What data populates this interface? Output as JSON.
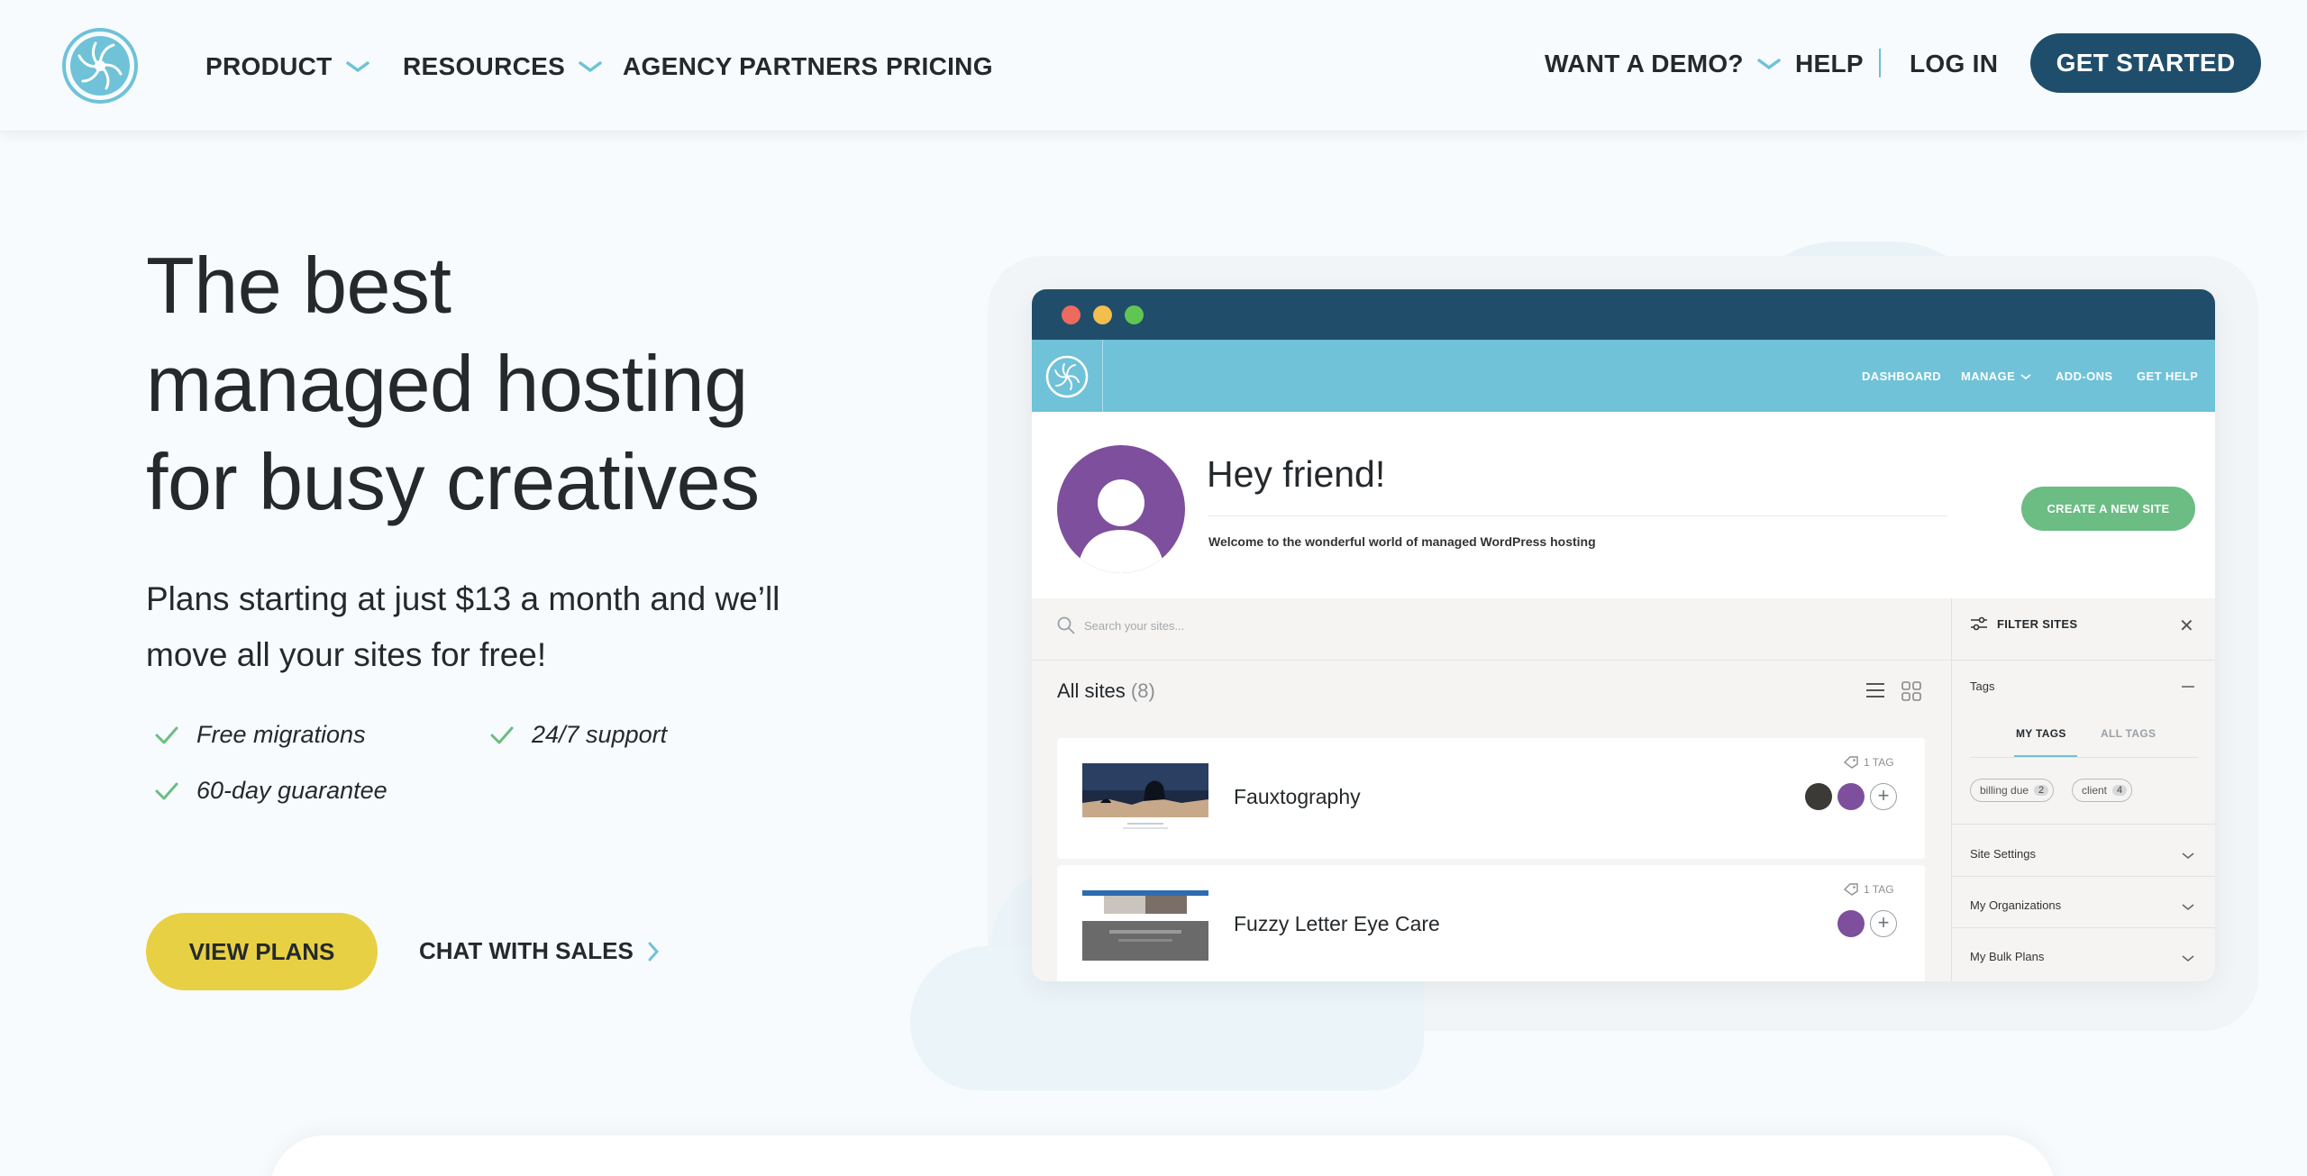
{
  "nav": {
    "product": "PRODUCT",
    "resources": "RESOURCES",
    "agency_partners": "AGENCY PARTNERS",
    "pricing": "PRICING",
    "want_demo": "WANT A DEMO?",
    "help": "HELP",
    "log_in": "LOG IN",
    "get_started": "GET STARTED"
  },
  "hero": {
    "title_line1": "The best",
    "title_line2": "managed hosting",
    "title_line3": "for busy creatives",
    "subtitle_line1": "Plans starting at just $13 a month and we’ll",
    "subtitle_line2": "move all your sites for free!",
    "features": [
      "Free migrations",
      "24/7 support",
      "60-day guarantee"
    ],
    "view_plans": "VIEW PLANS",
    "chat_sales": "CHAT WITH SALES"
  },
  "mockup": {
    "app_nav": {
      "dashboard": "DASHBOARD",
      "manage": "MANAGE",
      "addons": "ADD-ONS",
      "get_help": "GET HELP"
    },
    "greeting": "Hey friend!",
    "welcome": "Welcome to the wonderful world of managed WordPress hosting",
    "create_site": "CREATE A NEW SITE",
    "search_placeholder": "Search your sites...",
    "all_sites_label": "All sites",
    "all_sites_count": "(8)",
    "sites": [
      {
        "name": "Fauxtography",
        "tags": "1 TAG"
      },
      {
        "name": "Fuzzy Letter Eye Care",
        "tags": "1 TAG"
      }
    ],
    "filter": {
      "title": "FILTER SITES",
      "tags_label": "Tags",
      "my_tags": "MY TAGS",
      "all_tags": "ALL TAGS",
      "pills": [
        {
          "label": "billing due",
          "count": "2"
        },
        {
          "label": "client",
          "count": "4"
        }
      ],
      "sections": [
        "Site Settings",
        "My Organizations",
        "My Bulk Plans"
      ]
    }
  },
  "colors": {
    "brand_dark": "#1e4e6b",
    "brand_light": "#6fc2d8",
    "cta_yellow": "#e8d044",
    "success_green": "#6bbd84",
    "avatar_purple": "#7d4f9c"
  }
}
